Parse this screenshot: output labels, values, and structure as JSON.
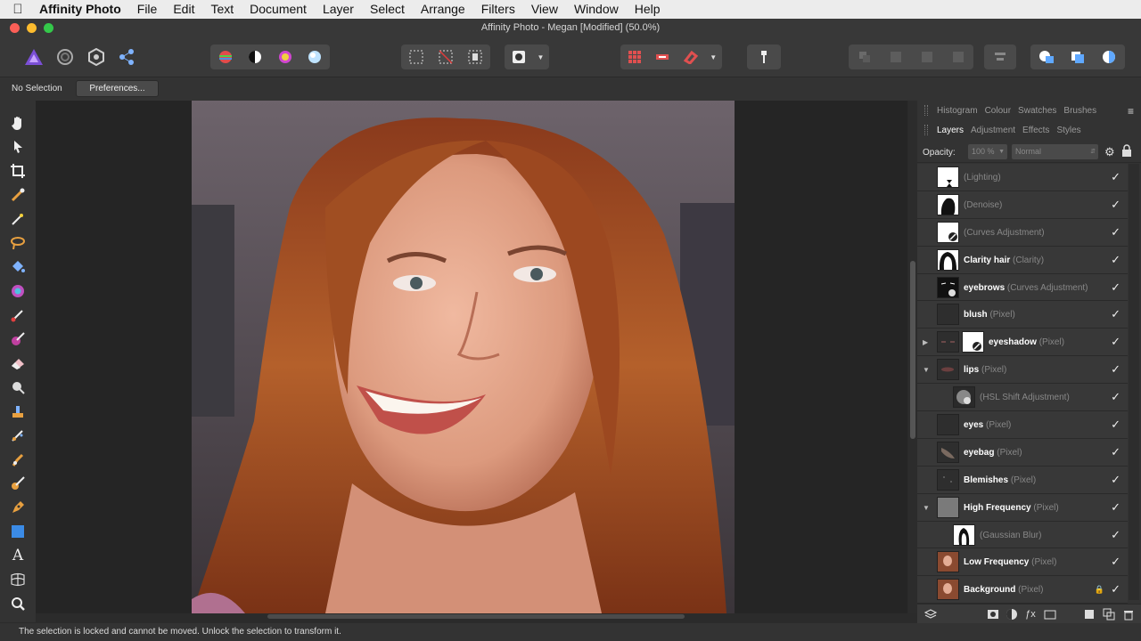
{
  "menubar": {
    "apple_icon": "apple-icon",
    "app_name": "Affinity Photo",
    "items": [
      "File",
      "Edit",
      "Text",
      "Document",
      "Layer",
      "Select",
      "Arrange",
      "Filters",
      "View",
      "Window",
      "Help"
    ]
  },
  "window": {
    "title": "Affinity Photo - Megan [Modified] (50.0%)"
  },
  "context": {
    "selection_label": "No Selection",
    "preferences_label": "Preferences..."
  },
  "panel": {
    "top_tabs": [
      "Histogram",
      "Colour",
      "Swatches",
      "Brushes"
    ],
    "tabs": [
      "Layers",
      "Adjustment",
      "Effects",
      "Styles"
    ],
    "opacity_label": "Opacity:",
    "opacity_value": "100 %",
    "blend_mode": "Normal",
    "layers": [
      {
        "name": "",
        "type": "(Lighting)"
      },
      {
        "name": "",
        "type": "(Denoise)"
      },
      {
        "name": "",
        "type": "(Curves Adjustment)"
      },
      {
        "name": "Clarity hair",
        "type": "(Clarity)"
      },
      {
        "name": "eyebrows",
        "type": "(Curves Adjustment)"
      },
      {
        "name": "blush",
        "type": "(Pixel)"
      },
      {
        "name": "eyeshadow",
        "type": "(Pixel)"
      },
      {
        "name": "lips",
        "type": "(Pixel)"
      },
      {
        "name": "",
        "type": "(HSL Shift Adjustment)"
      },
      {
        "name": "eyes",
        "type": "(Pixel)"
      },
      {
        "name": "eyebag",
        "type": "(Pixel)"
      },
      {
        "name": "Blemishes",
        "type": "(Pixel)"
      },
      {
        "name": "High Frequency",
        "type": "(Pixel)"
      },
      {
        "name": "",
        "type": "(Gaussian Blur)"
      },
      {
        "name": "Low Frequency",
        "type": "(Pixel)"
      },
      {
        "name": "Background",
        "type": "(Pixel)"
      }
    ]
  },
  "status": {
    "message": "The selection is locked and cannot be moved. Unlock the selection to transform it."
  },
  "colors": {
    "accent": "#7b4fd6",
    "close": "#fc5f57",
    "minimize": "#fdbc2e",
    "maximize": "#34c84a"
  }
}
